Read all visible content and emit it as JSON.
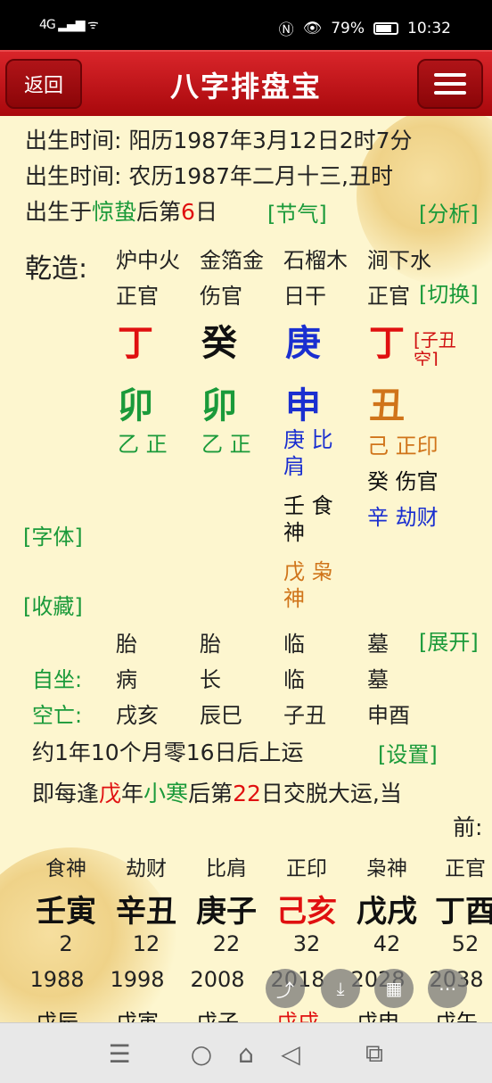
{
  "status_bar": {
    "signal": "4G",
    "battery": "79%",
    "battery_level": 0.79,
    "time": "10:32"
  },
  "header": {
    "back_label": "返回",
    "title": "八字排盘宝"
  },
  "birth": {
    "solar": "出生时间: 阳历1987年3月12日2时7分",
    "lunar": "出生时间: 农历1987年二月十三,丑时",
    "born_prefix": "出生于",
    "jieqi": "惊蛰",
    "born_mid": "后第",
    "born_day": "6",
    "born_suffix": "日",
    "jieqi_link": "[节气]",
    "analysis_link": "[分析]"
  },
  "chart": {
    "label": "乾造:",
    "nayin": [
      "炉中火",
      "金箔金",
      "石榴木",
      "涧下水"
    ],
    "shishen": [
      "正官",
      "伤官",
      "日干",
      "正官"
    ],
    "switch_link": "[切换]",
    "stems": [
      "丁",
      "癸",
      "庚",
      "丁"
    ],
    "stem_colors": [
      "#e01010",
      "#111111",
      "#1a2fd0",
      "#e01010"
    ],
    "branches": [
      "卯",
      "卯",
      "申",
      "丑"
    ],
    "branch_colors": [
      "#1a9a3a",
      "#1a9a3a",
      "#1a2fd0",
      "#d0741a"
    ],
    "kongwang_note": "[子丑空]",
    "hidden": {
      "col1": [
        "乙 正财"
      ],
      "col2": [
        "乙 正财"
      ],
      "col3": [
        "庚 比肩",
        "壬 食神",
        "戊 枭神"
      ],
      "col4": [
        "己 正印",
        "癸 伤官",
        "辛 劫财"
      ]
    },
    "hidden_colors": {
      "col1": [
        "#1a9a3a"
      ],
      "col2": [
        "#1a9a3a"
      ],
      "col3": [
        "#1a2fd0",
        "#111111",
        "#d0741a"
      ],
      "col4": [
        "#d0741a",
        "#111111",
        "#1a2fd0"
      ]
    },
    "font_link": "[字体]",
    "favorite_link": "[收藏]",
    "changsheng": [
      "胎",
      "胎",
      "临",
      "墓"
    ],
    "expand_link": "[展开]",
    "zizuo_label": "自坐:",
    "zizuo": [
      "病",
      "长",
      "临",
      "墓"
    ],
    "kongwang_label": "空亡:",
    "kongwang": [
      "戌亥",
      "辰巳",
      "子丑",
      "申酉"
    ]
  },
  "qiyun": {
    "text": "约1年10个月零16日后上运",
    "settings_link": "[设置]",
    "line2_a": "即每逢",
    "line2_stem": "戊",
    "line2_b": "年",
    "line2_jieqi": "小寒",
    "line2_c": "后第",
    "line2_day": "22",
    "line2_d": "日交脱大运,当",
    "line3": "前:"
  },
  "dayun": {
    "gods": [
      "食神",
      "劫财",
      "比肩",
      "正印",
      "枭神",
      "正官"
    ],
    "ganzhi": [
      "壬寅",
      "辛丑",
      "庚子",
      "己亥",
      "戊戌",
      "丁酉"
    ],
    "ganzhi_colors": [
      "#111111",
      "#111111",
      "#111111",
      "#e01010",
      "#111111",
      "#111111"
    ],
    "ages": [
      "2",
      "12",
      "22",
      "32",
      "42",
      "52"
    ],
    "years": [
      "1988",
      "1998",
      "2008",
      "2018",
      "2028",
      "2038"
    ],
    "liunian": [
      "戊辰",
      "戊寅",
      "戊子",
      "戊戌",
      "戊申",
      "戊午"
    ],
    "liunian_colors": [
      "#111111",
      "#111111",
      "#111111",
      "#e01010",
      "#111111",
      "#111111"
    ]
  },
  "floating_buttons": [
    "share-icon",
    "download-icon",
    "grid-icon",
    "more-icon"
  ],
  "nav_bar": [
    "menu-lines-icon",
    "circle-icon",
    "home-icon",
    "back-triangle-icon",
    "recent-apps-icon"
  ]
}
